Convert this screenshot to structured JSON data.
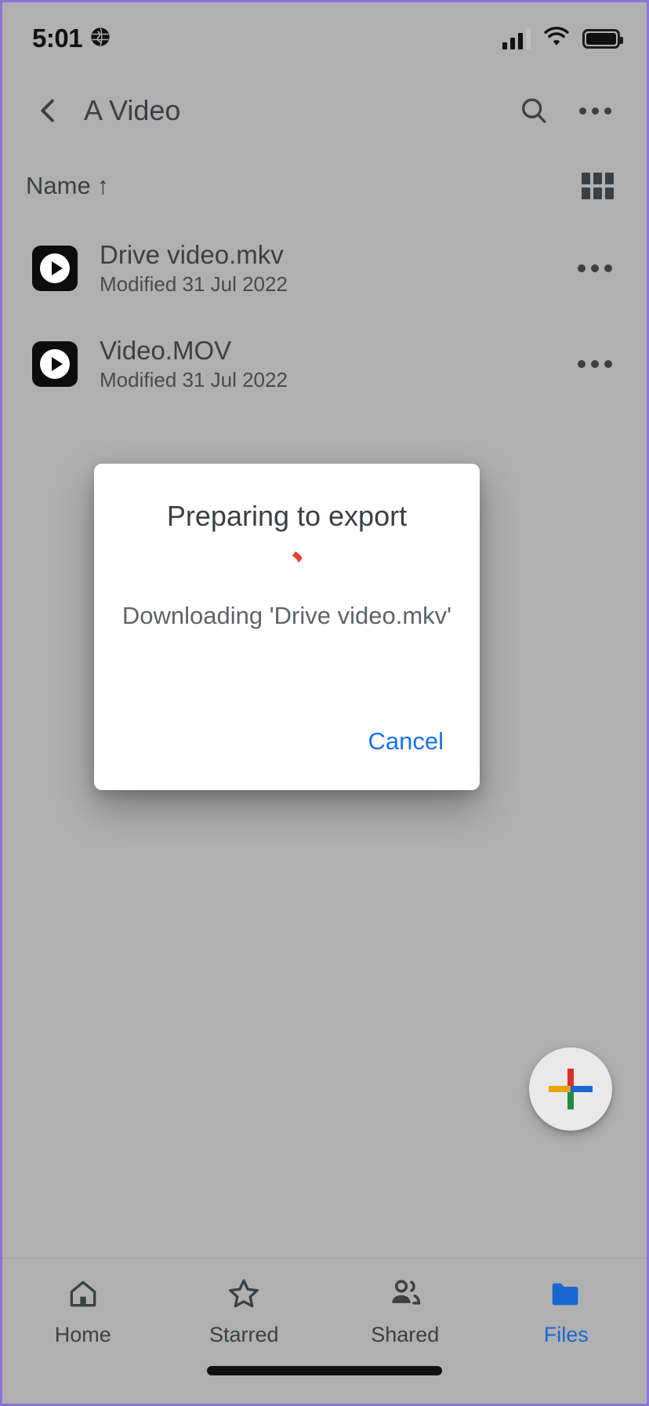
{
  "status_bar": {
    "time": "5:01",
    "globe_icon": "globe-icon",
    "signal_icon": "cellular-signal-icon",
    "wifi_icon": "wifi-icon",
    "battery_icon": "battery-full-icon"
  },
  "app_bar": {
    "back_icon": "chevron-left-icon",
    "title": "A Video",
    "search_icon": "search-icon",
    "overflow_icon": "more-vertical-icon"
  },
  "sort_bar": {
    "label": "Name",
    "direction_arrow": "↑",
    "view_toggle_icon": "grid-view-icon"
  },
  "files": [
    {
      "name": "Drive video.mkv",
      "subtitle": "Modified 31 Jul 2022",
      "icon": "video-file-icon",
      "more_icon": "more-horizontal-icon"
    },
    {
      "name": "Video.MOV",
      "subtitle": "Modified 31 Jul 2022",
      "icon": "video-file-icon",
      "more_icon": "more-horizontal-icon"
    }
  ],
  "dialog": {
    "title": "Preparing to export",
    "spinner_icon": "loading-spinner-icon",
    "spinner_color": "#e8412f",
    "message": "Downloading 'Drive video.mkv'",
    "cancel_label": "Cancel",
    "cancel_color": "#1a73e8"
  },
  "fab": {
    "icon": "plus-icon",
    "colors": {
      "top": "#d93025",
      "bottom": "#1e8e3e",
      "left": "#e8a400",
      "right": "#1967d2"
    }
  },
  "bottom_nav": {
    "active_color": "#1967d2",
    "items": [
      {
        "label": "Home",
        "icon": "home-icon",
        "active": false
      },
      {
        "label": "Starred",
        "icon": "star-icon",
        "active": false
      },
      {
        "label": "Shared",
        "icon": "people-icon",
        "active": false
      },
      {
        "label": "Files",
        "icon": "folder-icon",
        "active": true
      }
    ]
  },
  "theme": {
    "scrim_background": "#b0b0b0",
    "dialog_background": "#ffffff",
    "text_primary": "#3c4043",
    "text_secondary": "#5f6368"
  }
}
